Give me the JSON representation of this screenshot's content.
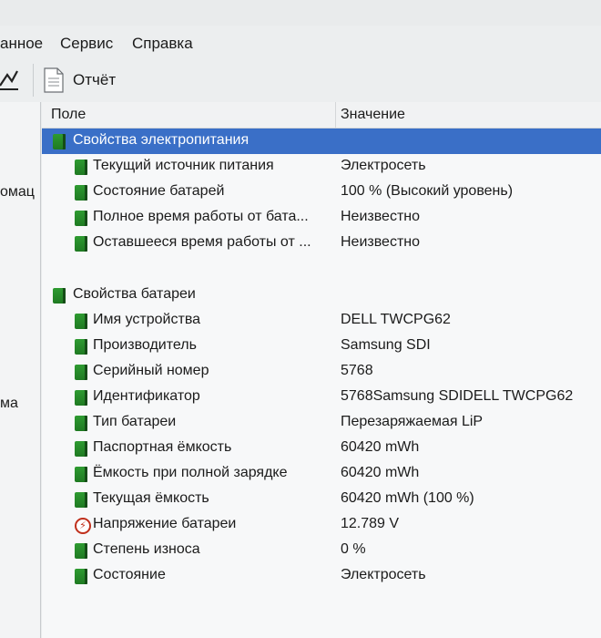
{
  "menu": {
    "items": [
      "анное",
      "Сервис",
      "Справка"
    ]
  },
  "toolbar": {
    "report_label": "Отчёт"
  },
  "left_pane": {
    "fragments": [
      "омац",
      "ма"
    ]
  },
  "columns": {
    "field": "Поле",
    "value": "Значение"
  },
  "power": {
    "label": "Свойства электропитания",
    "items": [
      {
        "label": "Текущий источник питания",
        "value": "Электросеть"
      },
      {
        "label": "Состояние батарей",
        "value": "100 % (Высокий уровень)"
      },
      {
        "label": "Полное время работы от бата...",
        "value": "Неизвестно"
      },
      {
        "label": "Оставшееся время работы от ...",
        "value": "Неизвестно"
      }
    ]
  },
  "battery": {
    "label": "Свойства батареи",
    "items": [
      {
        "label": "Имя устройства",
        "value": "DELL TWCPG62",
        "icon": "battery-icon"
      },
      {
        "label": "Производитель",
        "value": "Samsung SDI",
        "icon": "battery-icon"
      },
      {
        "label": "Серийный номер",
        "value": "5768",
        "icon": "battery-icon"
      },
      {
        "label": "Идентификатор",
        "value": "5768Samsung SDIDELL TWCPG62",
        "icon": "battery-icon"
      },
      {
        "label": "Тип батареи",
        "value": "Перезаряжаемая LiP",
        "icon": "battery-icon"
      },
      {
        "label": "Паспортная ёмкость",
        "value": "60420 mWh",
        "icon": "battery-icon"
      },
      {
        "label": "Ёмкость при полной зарядке",
        "value": "60420 mWh",
        "icon": "battery-icon"
      },
      {
        "label": "Текущая ёмкость",
        "value": "60420 mWh  (100 %)",
        "icon": "battery-icon"
      },
      {
        "label": "Напряжение батареи",
        "value": "12.789 V",
        "icon": "voltage-icon"
      },
      {
        "label": "Степень износа",
        "value": "0 %",
        "icon": "battery-icon"
      },
      {
        "label": "Состояние",
        "value": "Электросеть",
        "icon": "battery-icon"
      }
    ]
  }
}
